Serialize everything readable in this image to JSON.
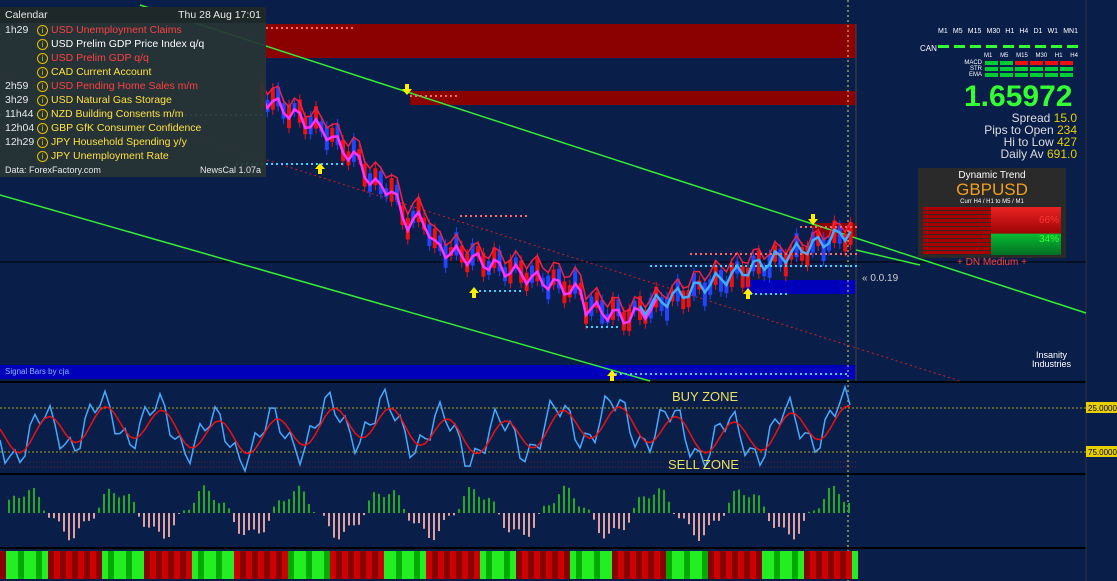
{
  "calendar": {
    "title": "Calendar",
    "datetime": "Thu 28 Aug 17:01",
    "events": [
      {
        "time": "1h29",
        "text": "USD Unemployment Claims",
        "color": "#ff4040"
      },
      {
        "time": "",
        "text": "USD Prelim GDP Price Index q/q",
        "color": "#ffffff"
      },
      {
        "time": "",
        "text": "USD Prelim GDP q/q",
        "color": "#ff4040"
      },
      {
        "time": "",
        "text": "CAD Current Account",
        "color": "#ffe040"
      },
      {
        "time": "2h59",
        "text": "USD Pending Home Sales m/m",
        "color": "#ff4040"
      },
      {
        "time": "3h29",
        "text": "USD Natural Gas Storage",
        "color": "#ffe040"
      },
      {
        "time": "11h44",
        "text": "NZD Building Consents m/m",
        "color": "#ffe040"
      },
      {
        "time": "12h04",
        "text": "GBP GfK Consumer Confidence",
        "color": "#ffe040"
      },
      {
        "time": "12h29",
        "text": "JPY Household Spending y/y",
        "color": "#ffe040"
      },
      {
        "time": "",
        "text": "JPY Unemployment Rate",
        "color": "#ffe040"
      }
    ],
    "source": "Data: ForexFactory.com",
    "version": "NewsCal 1.07a"
  },
  "timeframes": [
    "M1",
    "M5",
    "M15",
    "M30",
    "H1",
    "H4",
    "D1",
    "W1",
    "MN1"
  ],
  "can_label": "CAN",
  "tf_small": [
    "M1",
    "M5",
    "M15",
    "M30",
    "H1",
    "H4"
  ],
  "ind_labels": [
    "MACD",
    "STR",
    "EMA"
  ],
  "price": "1.65972",
  "stats": [
    {
      "label": "Spread",
      "value": "15.0"
    },
    {
      "label": "Pips to Open",
      "value": "234"
    },
    {
      "label": "Hi to Low",
      "value": "427"
    },
    {
      "label": "Daily Av",
      "value": "691.0"
    }
  ],
  "dynamic_trend": {
    "title": "Dynamic Trend",
    "pair": "GBPUSD",
    "sub": "Curr H4 / H1 to M5 / M1",
    "pct_red": "66%",
    "pct_green": "34%",
    "status": "+ DN Medium +"
  },
  "price_tag": "« 0.0.19",
  "signal_bars_label": "Signal Bars by cja",
  "logo": [
    "Insanity",
    "Industries"
  ],
  "zones": {
    "buy": "BUY ZONE",
    "sell": "SELL ZONE"
  },
  "levels": {
    "top": "25.0000",
    "bottom": "75.0000"
  },
  "colors": {
    "bg": "#0a1e4a",
    "channel": "#33ee33",
    "bull": "#2244ff",
    "bear": "#ee1111",
    "ma_pink": "#ff33ff",
    "ma_red": "#ee2244",
    "ma_blue": "#44aaff",
    "resist": "#8b0000",
    "support": "#0000cc"
  }
}
